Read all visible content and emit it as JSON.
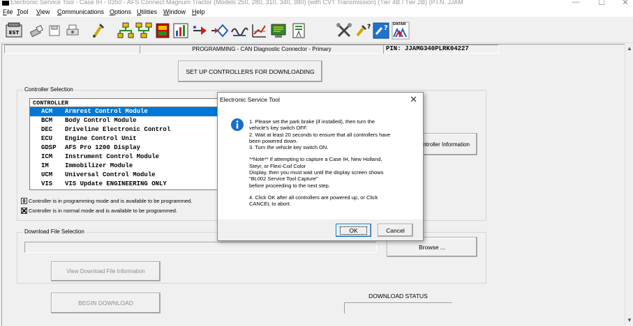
{
  "window": {
    "title": "Electronic Service Tool - Case IH - 0350 - AFS Connect Magnum Tractor (Models 250, 280, 310, 340, 380) (with CVT Transmission) (Tier 4B / Tier 2B) (P.I.N. JJAM",
    "minimize": "—",
    "maximize": "☐",
    "close": "✕"
  },
  "menu": {
    "items": [
      {
        "first": "F",
        "rest": "ile"
      },
      {
        "first": "T",
        "rest": "ool"
      },
      {
        "first": "V",
        "rest": "iew"
      },
      {
        "first": "C",
        "rest": "ommunications"
      },
      {
        "first": "O",
        "rest": "ptions"
      },
      {
        "first": "U",
        "rest": "tilities"
      },
      {
        "first": "W",
        "rest": "indow"
      },
      {
        "first": "H",
        "rest": "elp"
      }
    ]
  },
  "toolbar": {
    "icons": [
      "est-icon",
      "eraser-icon",
      "save-icon",
      "print-icon",
      "pipe-icon",
      "network-icon",
      "network-check-icon",
      "module-icon",
      "chart-icon",
      "arrow-right-icon",
      "arrow-diamond-icon",
      "waveform-icon",
      "graph-icon",
      "terminal-icon",
      "signal-tower-icon",
      "tools-icon",
      "wrench-question-icon",
      "help-settings-icon"
    ],
    "datar_label": "DATAR"
  },
  "header": {
    "mode_text": "PROGRAMMING  -  CAN Diagnostic Connector - Primary",
    "pin_text": "PIN:  JJAMG340PLRK04227"
  },
  "setup_button": "SET UP CONTROLLERS FOR DOWNLOADING",
  "controller_selection": {
    "legend": "Controller Selection",
    "header": "CONTROLLER",
    "rows": [
      {
        "code": "ACM",
        "name": "Armrest Control Module",
        "selected": true
      },
      {
        "code": "BCM",
        "name": "Body Control Module",
        "selected": false
      },
      {
        "code": "DEC",
        "name": "Driveline Electronic Control",
        "selected": false
      },
      {
        "code": "ECU",
        "name": "Engine Control Unit",
        "selected": false
      },
      {
        "code": "GDSP",
        "name": "AFS Pro 1200 Display",
        "selected": false
      },
      {
        "code": "ICM",
        "name": "Instrument Control Module",
        "selected": false
      },
      {
        "code": "IM",
        "name": "Immobilizer Module",
        "selected": false
      },
      {
        "code": "UCM",
        "name": "Universal Control Module",
        "selected": false
      },
      {
        "code": "VIS",
        "name": "VIS Update ENGINEERING ONLY",
        "selected": false
      }
    ],
    "info_button": "ntroller Information",
    "status_programming": "Controller is in programming mode and is available to be programmed.",
    "status_normal": "Controller is in normal mode and is available to be programmed."
  },
  "download_file": {
    "legend": "Download File Selection",
    "path_value": "",
    "browse_button": "Browse ...",
    "info_button": "View Download File Information"
  },
  "begin_button": "BEGIN DOWNLOAD",
  "download_status": {
    "label": "DOWNLOAD STATUS"
  },
  "dialog": {
    "title": "Electronic Service Tool",
    "close": "✕",
    "lines": [
      "1. Please set the park brake (if installed), then turn the",
      "vehicle's key switch OFF.",
      "2. Wait at least 20 seconds to ensure that all controllers have",
      "been powered down.",
      "3. Turn the vehicle key switch ON.",
      "",
      "**Note** If attempting to capture a Case IH, New Holland,",
      "Steyr, or Flexi-Coil Color",
      "Display, then you must wait until the display screen shows",
      "\"BL002 Service Tool Capture\"",
      "before proceeding to the next step.",
      "",
      "4.  Click OK after all controllers are powered up, or Click",
      "CANCEL to abort."
    ],
    "ok_button": "OK",
    "cancel_button": "Cancel"
  },
  "colors": {
    "selection": "#0078d7",
    "dialog_info_icon": "#1a6fc4"
  }
}
